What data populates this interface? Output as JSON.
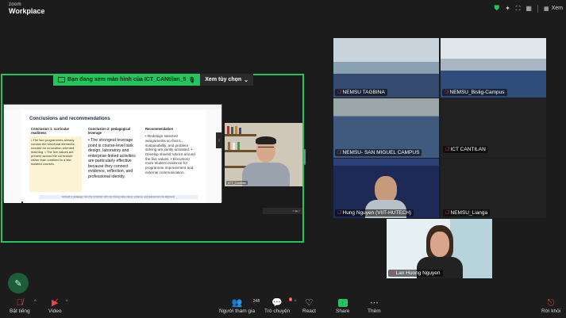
{
  "app": {
    "logo_line1": "zoom",
    "logo_line2": "Workplace",
    "view_label": "Xem"
  },
  "share": {
    "banner_message": "Bạn đang xem màn hình của  ICT_CANtilan_5",
    "view_options": "Xem tùy chọn"
  },
  "slide": {
    "title": "Conclusions and recommendations",
    "columns": [
      {
        "header": "Conclusion 1: curricular readiness",
        "body": "• The two programmes already contain the structural elements needed for innovation-oriented teaching. • The five values are present across the curriculum rather than confined to a few isolated courses."
      },
      {
        "header": "Conclusion 2: pedagogical leverage",
        "body": "• The strongest leverage point is course-level task design, laboratory and enterprise-linked activities are particularly effective because they connect evidence, reflection, and professional identity."
      },
      {
        "header": "Recommendation",
        "body": "• Redesign selected assignments so that IL, sustainability, and problem solving are jointly activated. • Develop shared rubrics around the five values. • Document more student evidence for programme improvement and external communication."
      }
    ],
    "footer": "Forward to pedagogy: from the curriculum with core driving value values, evidence, and assessment into alignment",
    "presenter_name": "ICT_Cantilan"
  },
  "participants": [
    {
      "name": "NEMSU TAGBINA",
      "muted": true
    },
    {
      "name": "NEMSU_Bislig-Campus",
      "muted": true
    },
    {
      "name": "NEMSU- SAN MIGUEL CAMPUS",
      "muted": true
    },
    {
      "name": "ICT CANTILAN",
      "muted": true
    },
    {
      "name": "Hung Nguyen (VIIT-HUTECH)",
      "muted": true
    },
    {
      "name": "NEMSU_Lianga",
      "muted": true
    },
    {
      "name": "Lan Huong Nguyen",
      "muted": true
    }
  ],
  "toolbar": {
    "audio": "Bật tiếng",
    "video": "Video",
    "participants": "Người tham gia",
    "participants_count": "243",
    "chat": "Trò chuyện",
    "chat_badge": "9",
    "react": "React",
    "share": "Share",
    "more": "Thêm",
    "leave": "Rời khỏi"
  },
  "colors": {
    "accent_green": "#22c55e",
    "danger_red": "#ef4444",
    "background": "#1c1c1c"
  }
}
